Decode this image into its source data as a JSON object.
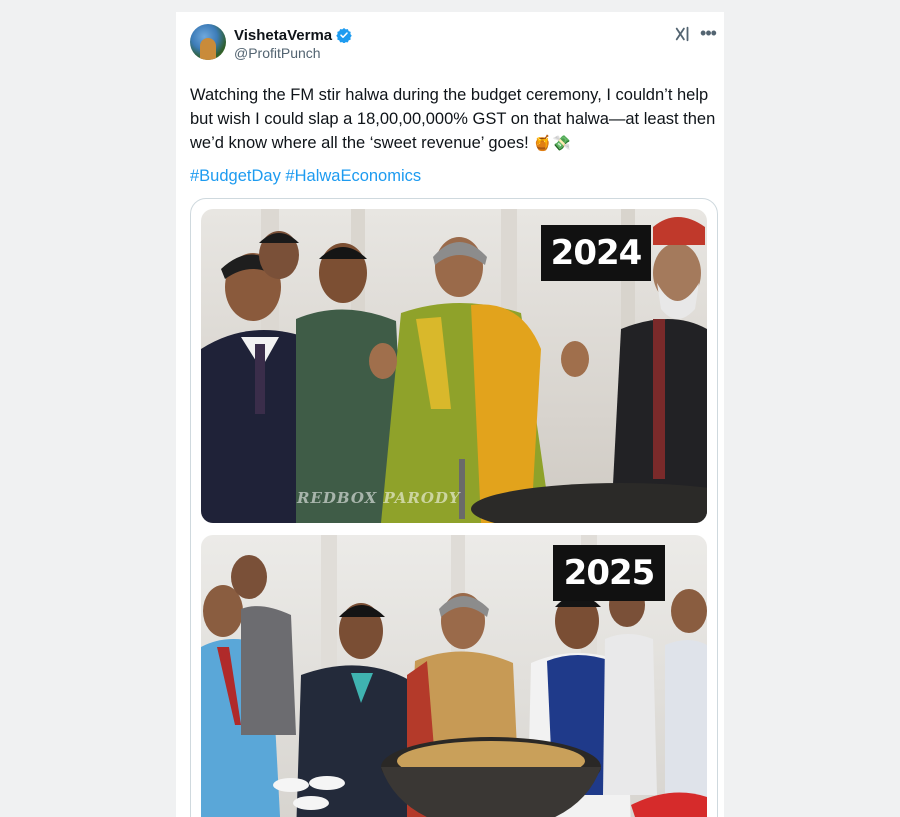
{
  "tweet": {
    "display_name": "VishetaVerma",
    "handle": "@ProfitPunch",
    "verified": true,
    "text": "Watching the FM stir halwa during the budget ceremony, I couldn’t help but wish I could slap a 18,00,00,000% GST on that halwa—at least then we’d know where all the ‘sweet revenue’ goes!",
    "emojis": "🍯💸",
    "hashtags": [
      "#BudgetDay",
      "#HalwaEconomics"
    ]
  },
  "header_icons": [
    "grok-icon",
    "more-icon"
  ],
  "media": {
    "top_image": {
      "year_label": "2024",
      "watermark": "REDBOX PARODY"
    },
    "bottom_image": {
      "year_label": "2025"
    }
  },
  "colors": {
    "background": "#f0f1f2",
    "card": "#ffffff",
    "text": "#0f1419",
    "secondary_text": "#536471",
    "link": "#1d9bf0",
    "verified": "#1d9bf0"
  }
}
